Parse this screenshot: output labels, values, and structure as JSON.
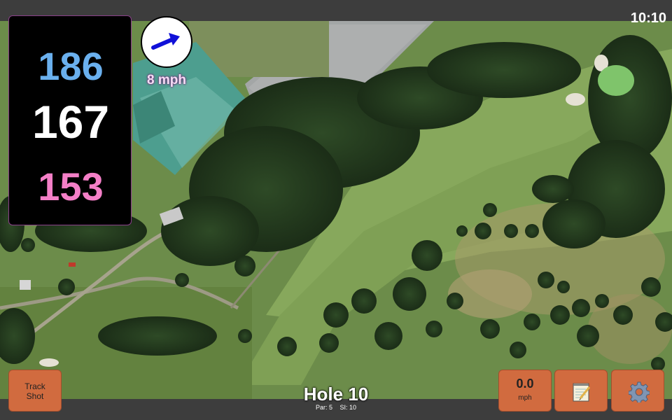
{
  "clock": "10:10",
  "distances": {
    "back": "186",
    "center": "167",
    "front": "153"
  },
  "wind": {
    "speed": "8 mph"
  },
  "hole": {
    "title": "Hole 10",
    "par": "Par: 5",
    "si": "SI: 10"
  },
  "buttons": {
    "track_shot": [
      "Track",
      "Shot"
    ],
    "speed_value": "0.0",
    "speed_unit": "mph",
    "notes_icon": "notepad-icon",
    "settings_icon": "gear-icon"
  },
  "colors": {
    "back": "#6ab0ee",
    "center": "#ffffff",
    "front": "#f47fc7",
    "button": "#d16b3f"
  }
}
